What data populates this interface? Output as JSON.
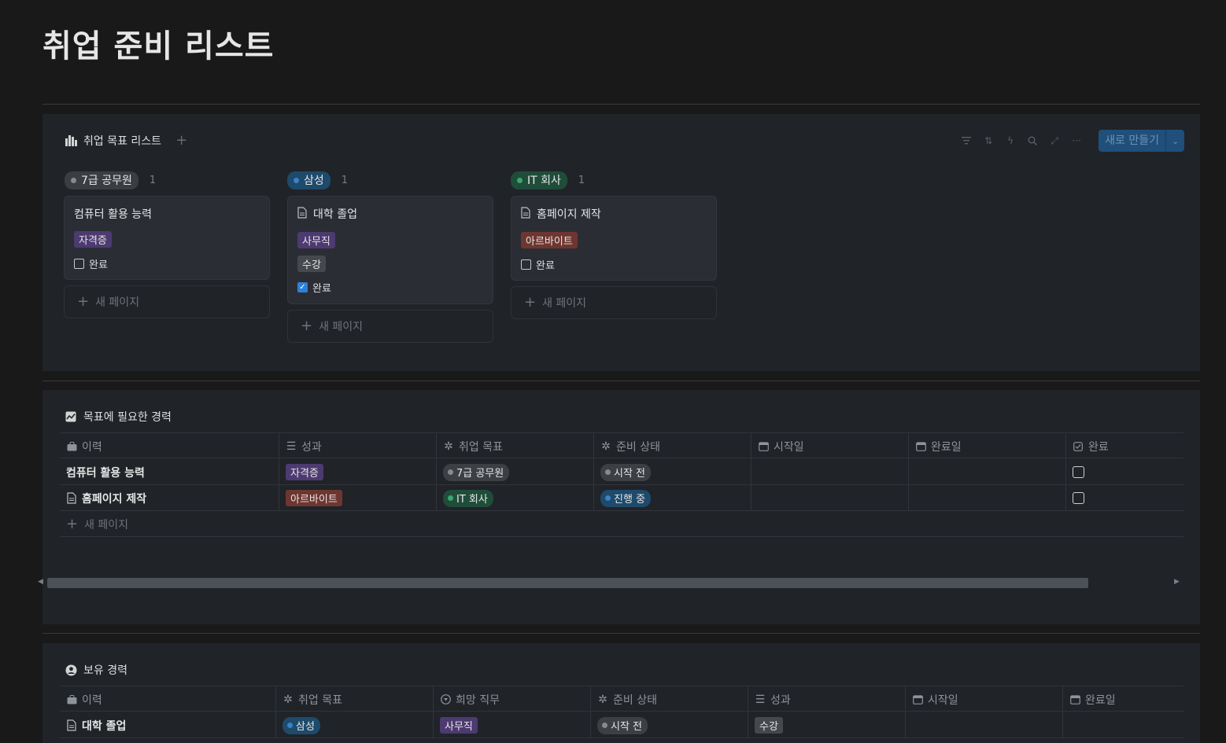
{
  "page": {
    "title": "취업 준비 리스트"
  },
  "board": {
    "title": "취업 목표 리스트",
    "new_button": "새로 만들기",
    "columns": [
      {
        "label": "7급 공무원",
        "count": "1",
        "dot": "#8a8a8a",
        "bg": "#3a3d42",
        "card": {
          "title": "컴퓨터 활용 능력",
          "tags": [
            "자격증"
          ],
          "tag_colors": [
            "purple"
          ],
          "done_label": "완료",
          "done": false
        }
      },
      {
        "label": "삼성",
        "count": "1",
        "dot": "#3b82c4",
        "bg": "#1e4a6b",
        "card": {
          "title": "대학 졸업",
          "tags": [
            "사무직",
            "수강"
          ],
          "tag_colors": [
            "purple",
            "gray"
          ],
          "done_label": "완료",
          "done": true
        }
      },
      {
        "label": "IT 회사",
        "count": "1",
        "dot": "#3aa66f",
        "bg": "#1f4d3a",
        "card": {
          "title": "홈페이지 제작",
          "tags": [
            "아르바이트"
          ],
          "tag_colors": [
            "red"
          ],
          "done_label": "완료",
          "done": false
        }
      }
    ],
    "new_page": "새 페이지"
  },
  "career_needed": {
    "title": "목표에 필요한 경력",
    "headers": [
      "이력",
      "성과",
      "취업 목표",
      "준비 상태",
      "시작일",
      "완료일",
      "완료"
    ],
    "rows": [
      {
        "name": "컴퓨터 활용 능력",
        "result": "자격증",
        "goal": "7급 공무원",
        "status": "시작 전"
      },
      {
        "name": "홈페이지 제작",
        "result": "아르바이트",
        "goal": "IT 회사",
        "status": "진행 중"
      }
    ],
    "new_page": "새 페이지"
  },
  "career_owned": {
    "title": "보유 경력",
    "headers": [
      "이력",
      "취업 목표",
      "희망 직무",
      "준비 상태",
      "성과",
      "시작일",
      "완료일"
    ],
    "rows": [
      {
        "name": "대학 졸업",
        "goal": "삼성",
        "job": "사무직",
        "status": "시작 전",
        "result": "수강"
      }
    ]
  }
}
